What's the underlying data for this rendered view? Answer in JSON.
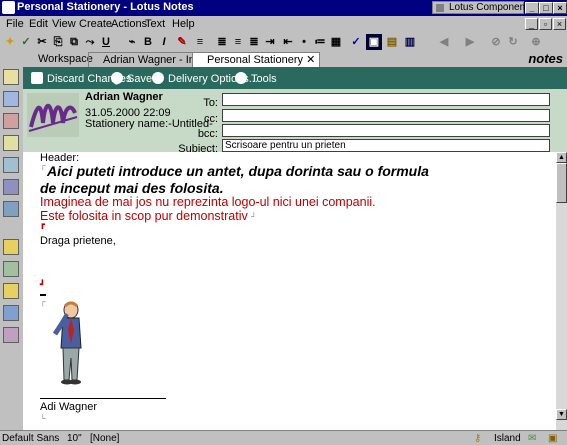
{
  "window": {
    "title": "Personal Stationery - Lotus Notes",
    "component_box": "Lotus Components"
  },
  "menu": [
    "File",
    "Edit",
    "View",
    "Create",
    "Actions",
    "Text",
    "Help"
  ],
  "tabs": {
    "workspace": "Workspace",
    "inbox": "Adrian Wagner - Inbox",
    "stationery": "Personal Stationery"
  },
  "brand": "notes",
  "actions": {
    "discard": "Discard Changes",
    "save": "Save",
    "delivery": "Delivery Options...",
    "tools": "Tools"
  },
  "memo": {
    "sender": "Adrian Wagner",
    "date": "31.05.2000 22:09",
    "stationery_name": "Stationery name:-Untitled-",
    "labels": {
      "to": "To:",
      "cc": "cc:",
      "bcc": "bcc:",
      "subject": "Subject:"
    },
    "subject_value": "Scrisoare pentru un prieten"
  },
  "body": {
    "header_label": "Header:",
    "line1": "Aici puteti introduce un antet, dupa dorinta sau o formula",
    "line2": "de inceput mai des folosita.",
    "red1": "Imaginea de mai jos nu reprezinta logo-ul nici unei companii.",
    "red2": "Este folosita in scop pur demonstrativ",
    "greeting": "Draga prietene,",
    "signature": "Adi Wagner"
  },
  "status": {
    "font": "Default Sans",
    "size": "10",
    "style": "[None]",
    "location": "Island"
  },
  "colors": {
    "titlebar": "#000080",
    "actionbar": "#2a6a5e",
    "header_bg": "#c7d9c7",
    "red_text": "#c00000"
  }
}
